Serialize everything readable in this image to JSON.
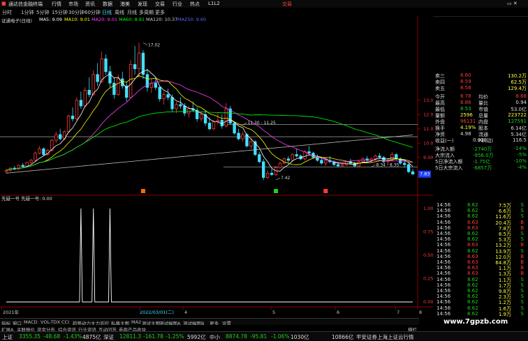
{
  "app": {
    "title": "通达信金融终端",
    "menu": [
      "行情",
      "市场",
      "资讯",
      "数据",
      "港美",
      "发现",
      "交易",
      "行业",
      "热点",
      "L1L2"
    ],
    "right_link": "交易"
  },
  "periods": [
    "分时",
    "1分钟",
    "5分钟",
    "15分钟",
    "30分钟",
    "60分钟",
    "日线",
    "周线",
    "月线",
    "多周期",
    "更多"
  ],
  "active_period": "日线",
  "ma_legend": {
    "name": "证通电子(日线)",
    "items": [
      {
        "label": "MA5: 9.09",
        "color": "#ffffff"
      },
      {
        "label": "MA10: 9.01",
        "color": "#ffff00"
      },
      {
        "label": "MA20: 9.01",
        "color": "#ff40ff"
      },
      {
        "label": "MA60: 8.91",
        "color": "#00ff00"
      },
      {
        "label": "MA120: 10.37",
        "color": "#cccccc"
      },
      {
        "label": "MA250: 9.60",
        "color": "#6060ff"
      }
    ]
  },
  "chart_data": {
    "type": "candlestick",
    "price_axis": {
      "ticks": [
        "13.00",
        "12.00",
        "11.00",
        "10.00",
        "9.00"
      ],
      "ylim": [
        6.5,
        18.5
      ]
    },
    "annotations": [
      {
        "text": "17.02",
        "x": 33,
        "price": 17.02
      },
      {
        "text": "7.42",
        "x": 65,
        "price": 7.42
      },
      {
        "text": "11.30 - 11.25",
        "x": 57,
        "price": 11.28
      },
      {
        "text": "8.34 - 8.35",
        "x": 88,
        "price": 8.34
      }
    ],
    "level_lines": [
      {
        "price": 11.3,
        "color": "#bbbbbb"
      },
      {
        "price": 10.45,
        "color": "#cccccc"
      },
      {
        "price": 8.34,
        "color": "#bbbbbb"
      }
    ],
    "current_price_label": "7.83",
    "sub_indicator": {
      "title": "先疑一号 先疑一号: 0.00",
      "ticks": [
        "1.00",
        "0.75",
        "0.50",
        "0.25",
        "0.00"
      ],
      "spikes": [
        18,
        21,
        25
      ],
      "spike_value": 1.0
    },
    "time_axis": [
      "2021年",
      "2022/03/01(二)",
      "4",
      "5",
      "6",
      "7",
      "8"
    ],
    "candles": [
      [
        8.0,
        8.2,
        7.9,
        8.1
      ],
      [
        8.1,
        8.3,
        8.0,
        8.25
      ],
      [
        8.25,
        8.4,
        8.1,
        8.2
      ],
      [
        8.2,
        8.5,
        8.1,
        8.45
      ],
      [
        8.45,
        8.6,
        8.3,
        8.35
      ],
      [
        8.35,
        8.7,
        8.3,
        8.65
      ],
      [
        8.65,
        8.9,
        8.5,
        8.8
      ],
      [
        8.8,
        9.4,
        8.7,
        9.3
      ],
      [
        9.3,
        9.8,
        9.2,
        9.6
      ],
      [
        9.6,
        9.7,
        9.1,
        9.2
      ],
      [
        9.2,
        9.6,
        9.1,
        9.5
      ],
      [
        9.5,
        10.3,
        9.4,
        10.2
      ],
      [
        10.2,
        10.8,
        10.0,
        10.6
      ],
      [
        10.6,
        11.0,
        10.2,
        10.3
      ],
      [
        10.3,
        10.9,
        10.2,
        10.8
      ],
      [
        10.8,
        12.0,
        10.7,
        11.9
      ],
      [
        11.9,
        12.5,
        11.5,
        11.7
      ],
      [
        11.7,
        13.2,
        11.6,
        13.0
      ],
      [
        13.0,
        13.6,
        12.4,
        12.6
      ],
      [
        12.6,
        13.9,
        12.5,
        13.7
      ],
      [
        13.7,
        14.6,
        13.2,
        13.4
      ],
      [
        13.4,
        15.1,
        13.3,
        14.8
      ],
      [
        14.8,
        15.6,
        14.0,
        14.3
      ],
      [
        14.3,
        16.4,
        14.2,
        15.9
      ],
      [
        15.9,
        16.2,
        14.8,
        15.0
      ],
      [
        15.0,
        15.4,
        13.9,
        14.2
      ],
      [
        14.2,
        14.6,
        13.1,
        13.4
      ],
      [
        13.4,
        14.8,
        13.3,
        14.5
      ],
      [
        14.5,
        15.0,
        13.8,
        14.0
      ],
      [
        14.0,
        14.3,
        12.9,
        13.2
      ],
      [
        13.2,
        15.8,
        13.1,
        15.5
      ],
      [
        15.5,
        16.8,
        14.8,
        15.2
      ],
      [
        15.2,
        17.02,
        14.6,
        16.3
      ],
      [
        16.3,
        16.5,
        14.5,
        14.8
      ],
      [
        14.8,
        15.2,
        13.6,
        13.9
      ],
      [
        13.9,
        14.5,
        13.5,
        14.2
      ],
      [
        14.2,
        14.6,
        13.7,
        13.9
      ],
      [
        13.9,
        14.0,
        12.9,
        13.1
      ],
      [
        13.1,
        13.6,
        12.7,
        13.4
      ],
      [
        13.4,
        13.8,
        13.0,
        13.2
      ],
      [
        13.2,
        13.4,
        12.2,
        12.4
      ],
      [
        12.4,
        12.9,
        12.1,
        12.7
      ],
      [
        12.7,
        13.2,
        12.4,
        12.6
      ],
      [
        12.6,
        12.8,
        11.9,
        12.1
      ],
      [
        12.1,
        12.6,
        11.8,
        12.4
      ],
      [
        12.4,
        12.9,
        12.2,
        12.3
      ],
      [
        12.3,
        12.5,
        11.5,
        11.7
      ],
      [
        11.7,
        12.2,
        11.5,
        12.0
      ],
      [
        12.0,
        12.3,
        11.2,
        11.4
      ],
      [
        11.4,
        11.8,
        10.9,
        11.0
      ],
      [
        11.0,
        11.6,
        10.9,
        11.5
      ],
      [
        11.5,
        12.1,
        11.3,
        11.6
      ],
      [
        11.6,
        12.0,
        11.0,
        11.2
      ],
      [
        11.2,
        12.8,
        11.1,
        12.4
      ],
      [
        12.4,
        12.6,
        11.3,
        11.4
      ],
      [
        11.4,
        11.5,
        10.6,
        10.7
      ],
      [
        10.7,
        11.0,
        10.2,
        10.3
      ],
      [
        10.3,
        10.8,
        10.1,
        10.6
      ],
      [
        10.6,
        10.7,
        9.7,
        9.8
      ],
      [
        9.8,
        10.3,
        9.6,
        10.1
      ],
      [
        10.1,
        10.2,
        9.1,
        9.2
      ],
      [
        9.2,
        9.4,
        8.6,
        8.7
      ],
      [
        8.7,
        8.9,
        7.42,
        7.6
      ],
      [
        7.6,
        8.1,
        7.5,
        7.9
      ],
      [
        7.9,
        8.2,
        7.7,
        7.8
      ],
      [
        7.8,
        8.4,
        7.7,
        8.3
      ],
      [
        8.3,
        8.7,
        8.2,
        8.6
      ],
      [
        8.6,
        9.0,
        8.5,
        8.9
      ],
      [
        8.9,
        9.1,
        8.6,
        8.8
      ],
      [
        8.8,
        9.3,
        8.7,
        9.2
      ],
      [
        9.2,
        9.6,
        9.0,
        9.1
      ],
      [
        9.1,
        9.2,
        8.8,
        8.9
      ],
      [
        8.9,
        9.5,
        8.8,
        9.4
      ],
      [
        9.4,
        9.8,
        9.2,
        9.3
      ],
      [
        9.3,
        9.4,
        8.9,
        9.0
      ],
      [
        9.0,
        9.2,
        8.7,
        8.8
      ],
      [
        8.8,
        9.0,
        8.5,
        8.6
      ],
      [
        8.6,
        8.9,
        8.4,
        8.8
      ],
      [
        8.8,
        9.1,
        8.6,
        8.7
      ],
      [
        8.7,
        8.8,
        8.4,
        8.5
      ],
      [
        8.5,
        8.7,
        8.3,
        8.4
      ],
      [
        8.4,
        8.6,
        8.34,
        8.5
      ],
      [
        8.5,
        8.8,
        8.4,
        8.7
      ],
      [
        8.7,
        8.9,
        8.5,
        8.6
      ],
      [
        8.6,
        8.7,
        8.35,
        8.4
      ],
      [
        8.4,
        8.8,
        8.3,
        8.7
      ],
      [
        8.7,
        9.0,
        8.6,
        8.9
      ],
      [
        8.9,
        9.1,
        8.7,
        8.8
      ],
      [
        8.8,
        9.0,
        8.6,
        8.9
      ],
      [
        8.9,
        9.2,
        8.8,
        9.1
      ],
      [
        9.1,
        9.3,
        8.9,
        9.0
      ],
      [
        9.0,
        9.1,
        8.6,
        8.7
      ],
      [
        8.7,
        8.9,
        8.5,
        8.8
      ],
      [
        8.8,
        9.4,
        8.7,
        9.2
      ],
      [
        9.2,
        9.3,
        8.8,
        8.9
      ],
      [
        8.9,
        9.0,
        8.5,
        8.6
      ],
      [
        8.6,
        8.8,
        8.3,
        8.5
      ],
      [
        8.5,
        8.6,
        7.9,
        8.0
      ],
      [
        8.0,
        8.2,
        7.8,
        7.83
      ]
    ]
  },
  "quote": {
    "rows": [
      {
        "label": "卖三",
        "v1": "8.60",
        "v2": "130.2万",
        "c1": "red",
        "c2": "yellow"
      },
      {
        "label": "卖四",
        "v1": "8.59",
        "v2": "62.5万",
        "c1": "red",
        "c2": "yellow"
      },
      {
        "label": "卖五",
        "v1": "8.58",
        "v2": "129.4万",
        "c1": "red",
        "c2": "yellow"
      },
      {
        "label": "今开",
        "v1": "8.78",
        "l2": "均价",
        "v3": "8.68",
        "c1": "red",
        "c3": "red"
      },
      {
        "label": "最高",
        "v1": "8.86",
        "l2": "量比",
        "v3": "0.94",
        "c1": "red",
        "c3": "white"
      },
      {
        "label": "最低",
        "v1": "8.53",
        "l2": "市值",
        "v3": "53.0亿",
        "c1": "green",
        "c3": "white"
      },
      {
        "label": "量额",
        "v1": "2596",
        "l2": "总量",
        "v3": "223722",
        "c1": "yellow",
        "c3": "yellow"
      },
      {
        "label": "外盘",
        "v1": "96131",
        "l2": "内盘",
        "v3": "127591",
        "c1": "red",
        "c3": "green"
      },
      {
        "label": "换手",
        "v1": "4.19%",
        "l2": "股本",
        "v3": "6.14亿",
        "c1": "yellow",
        "c3": "white"
      },
      {
        "label": "净资",
        "v1": "4.98",
        "l2": "流通",
        "v3": "5.34亿",
        "c1": "white",
        "c3": "white"
      },
      {
        "label": "收益(一)",
        "v1": "0.020",
        "l2": "PE(动)",
        "v3": "116.5",
        "c1": "white",
        "c3": "white"
      },
      {
        "label": "净流入额",
        "v1": "-2740万",
        "v3": "-14%",
        "c1": "green",
        "c3": "green"
      },
      {
        "label": "大宗流入",
        "v1": "-956.0万",
        "v3": "-5%",
        "c1": "green",
        "c3": "green"
      },
      {
        "label": "5日净流入额",
        "v1": "-1.75亿",
        "v3": "-10%",
        "c1": "green",
        "c3": "green"
      },
      {
        "label": "5日大宗流入",
        "v1": "-6857万",
        "v3": "-4%",
        "c1": "green",
        "c3": "green"
      }
    ]
  },
  "ticks": [
    {
      "t": "14:56",
      "p": "8.62",
      "v": "7.5万",
      "s": "S",
      "c": "green"
    },
    {
      "t": "14:56",
      "p": "8.62",
      "v": "6.6万",
      "s": "S",
      "c": "green"
    },
    {
      "t": "14:56",
      "p": "8.62",
      "v": "11.6万",
      "s": "S",
      "c": "green"
    },
    {
      "t": "14:56",
      "p": "8.63",
      "v": "20.4万",
      "s": "B",
      "c": "red"
    },
    {
      "t": "14:56",
      "p": "8.63",
      "v": "7.8万",
      "s": "B",
      "c": "red"
    },
    {
      "t": "14:56",
      "p": "8.62",
      "v": "8.5万",
      "s": "S",
      "c": "green"
    },
    {
      "t": "14:56",
      "p": "8.62",
      "v": "5.3万",
      "s": "S",
      "c": "green"
    },
    {
      "t": "14:56",
      "p": "8.63",
      "v": "13.2万",
      "s": "B",
      "c": "red"
    },
    {
      "t": "14:56",
      "p": "8.62",
      "v": "13.9万",
      "s": "S",
      "c": "green"
    },
    {
      "t": "14:56",
      "p": "8.63",
      "v": "12.0万",
      "s": "B",
      "c": "red"
    },
    {
      "t": "14:56",
      "p": "8.63",
      "v": "64.8万",
      "s": "B",
      "c": "red"
    },
    {
      "t": "14:56",
      "p": "8.63",
      "v": "1.1万",
      "s": "B",
      "c": "red"
    },
    {
      "t": "14:56",
      "p": "8.63",
      "v": "1.3万",
      "s": "B",
      "c": "red"
    },
    {
      "t": "14:56",
      "p": "8.62",
      "v": "1.1万",
      "s": "S",
      "c": "green"
    },
    {
      "t": "14:56",
      "p": "8.62",
      "v": "1.7万",
      "s": "S",
      "c": "green"
    },
    {
      "t": "14:56",
      "p": "8.62",
      "v": "9.8万",
      "s": "S",
      "c": "green"
    },
    {
      "t": "14:56",
      "p": "8.62",
      "v": "2.3万",
      "s": "S",
      "c": "green"
    },
    {
      "t": "14:56",
      "p": "8.62",
      "v": "1.2万",
      "s": "S",
      "c": "green"
    },
    {
      "t": "14:56",
      "p": "8.62",
      "v": "1.6万",
      "s": "S",
      "c": "green"
    },
    {
      "t": "14:56",
      "p": "8.62",
      "v": "1.9万",
      "s": "S",
      "c": "green"
    }
  ],
  "tabs": [
    "指标",
    "窗口",
    "MACD",
    "VOL-TDX",
    "CCI",
    "趋势动力",
    "主力监控",
    "私募主图",
    "MA2",
    "测试主图",
    "测试幅图A",
    "测试幅图B",
    "更多",
    "设置"
  ],
  "tabs2": [
    "扩展A",
    "关联报价",
    "资金分布",
    "综合资讯",
    "行业资讯",
    "互动问答",
    "券商产品收益",
    "横栏"
  ],
  "status": [
    {
      "text": "上证",
      "c": "white"
    },
    {
      "text": "3355.35",
      "c": "green"
    },
    {
      "text": "-48.68",
      "c": "green"
    },
    {
      "text": "-1.43%",
      "c": "green"
    },
    {
      "text": "4875亿",
      "c": "white"
    },
    {
      "text": "深证",
      "c": "white"
    },
    {
      "text": "12811.3",
      "c": "green"
    },
    {
      "text": "-161.78",
      "c": "green"
    },
    {
      "text": "-1.25%",
      "c": "green"
    },
    {
      "text": "5992亿",
      "c": "white"
    },
    {
      "text": "中小",
      "c": "white"
    },
    {
      "text": "8874.78",
      "c": "green"
    },
    {
      "text": "-95.81",
      "c": "green"
    },
    {
      "text": "-1.06%",
      "c": "green"
    },
    {
      "text": "1030亿",
      "c": "white"
    },
    {
      "text": "10866亿",
      "c": "white"
    },
    {
      "text": "平安证券上海上证云行情",
      "c": "white"
    }
  ],
  "watermark": "www.7gpzb.com"
}
